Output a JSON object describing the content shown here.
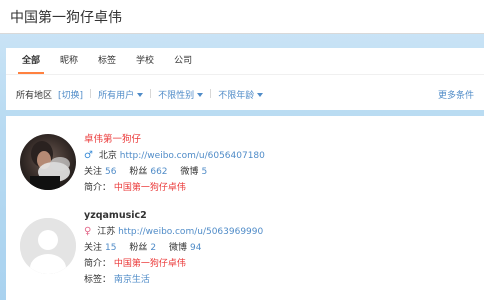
{
  "search": {
    "query": "中国第一狗仔卓伟"
  },
  "tabs": [
    {
      "label": "全部",
      "active": true
    },
    {
      "label": "昵称"
    },
    {
      "label": "标签"
    },
    {
      "label": "学校"
    },
    {
      "label": "公司"
    }
  ],
  "filters": {
    "region_label": "所有地区",
    "switch_label": "[切换]",
    "users": "所有用户",
    "gender": "不限性别",
    "age": "不限年龄",
    "more": "更多条件"
  },
  "results": [
    {
      "name": "卓伟第一狗仔",
      "gender_icon": "male-icon",
      "location": "北京",
      "url": "http://weibo.com/u/6056407180",
      "follow_label": "关注",
      "follow": "56",
      "fans_label": "粉丝",
      "fans": "662",
      "weibo_label": "微博",
      "weibo": "5",
      "intro_label": "简介：",
      "intro": "中国第一狗仔卓伟"
    },
    {
      "name": "yzqamusic2",
      "gender_icon": "female-icon",
      "location": "江苏",
      "url": "http://weibo.com/u/5063969990",
      "follow_label": "关注",
      "follow": "15",
      "fans_label": "粉丝",
      "fans": "2",
      "weibo_label": "微博",
      "weibo": "94",
      "intro_label": "简介：",
      "intro": "中国第一狗仔卓伟",
      "tags_label": "标签：",
      "tags": "南京生活"
    }
  ]
}
